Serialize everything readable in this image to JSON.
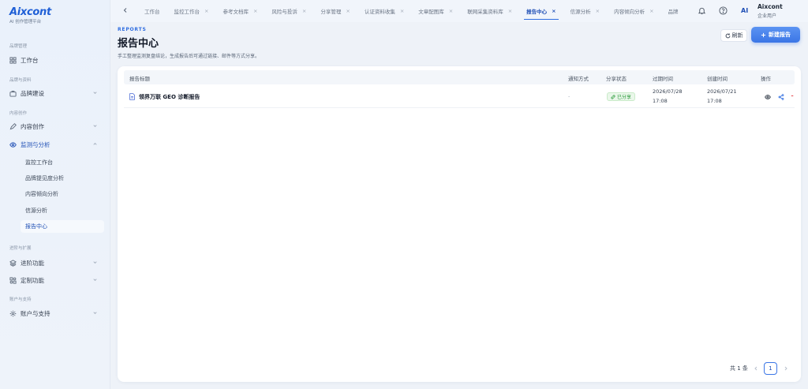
{
  "brand": {
    "logo": "Aixcont",
    "subtitle": "AI 创作管理平台"
  },
  "sidebar": {
    "sections": [
      {
        "title": "品牌管理"
      },
      {
        "title": "品牌与资料"
      },
      {
        "title": "内容创作"
      },
      {
        "title": "进阶与扩展"
      },
      {
        "title": "账户与支持"
      }
    ],
    "items": [
      {
        "label": "工作台",
        "icon": "grid-icon"
      },
      {
        "label": "品牌建设",
        "icon": "briefcase-icon"
      },
      {
        "label": "内容创作",
        "icon": "pen-icon"
      },
      {
        "label": "监测与分析",
        "icon": "eye-icon"
      },
      {
        "label": "进阶功能",
        "icon": "layers-icon"
      },
      {
        "label": "定制功能",
        "icon": "puzzle-icon"
      },
      {
        "label": "账户与支持",
        "icon": "gear-icon"
      }
    ],
    "subitems": [
      {
        "label": "监控工作台"
      },
      {
        "label": "品牌提见度分析"
      },
      {
        "label": "内容倾向分析"
      },
      {
        "label": "信源分析"
      },
      {
        "label": "报告中心"
      }
    ]
  },
  "topbar": {
    "tabs": [
      {
        "label": "工作台"
      },
      {
        "label": "监控工作台"
      },
      {
        "label": "参考文档库"
      },
      {
        "label": "风险与投诉"
      },
      {
        "label": "分享管理"
      },
      {
        "label": "认证资料收集"
      },
      {
        "label": "文章配图库"
      },
      {
        "label": "联网采集资料库"
      },
      {
        "label": "报告中心"
      },
      {
        "label": "信源分析"
      },
      {
        "label": "内容倾向分析"
      },
      {
        "label": "品牌"
      }
    ],
    "close_glyph": "×",
    "ai_mark": "AI",
    "user_name": "Aixcont",
    "user_role": "企业用户"
  },
  "page": {
    "eyebrow": "REPORTS",
    "title": "报告中心",
    "description": "手工整理监测复盘结论，生成报告后可通过链接、邮件等方式分享。",
    "refresh_label": "刷新",
    "new_label": "新建报告"
  },
  "table": {
    "headers": [
      "报告标题",
      "通知方式",
      "分享状态",
      "过期时间",
      "创建时间",
      "操作"
    ],
    "rows": [
      {
        "title": "领界万联 GEO 诊断报告",
        "notify": "-",
        "share_status": "已分享",
        "expire_date": "2026/07/28",
        "expire_time": "17:08",
        "create_date": "2026/07/21",
        "create_time": "17:08"
      }
    ]
  },
  "pager": {
    "total": "共 1 条",
    "page": "1"
  },
  "colors": {
    "accent": "#2f6de0",
    "success": "#2f9d3f",
    "danger": "#e5484d"
  }
}
